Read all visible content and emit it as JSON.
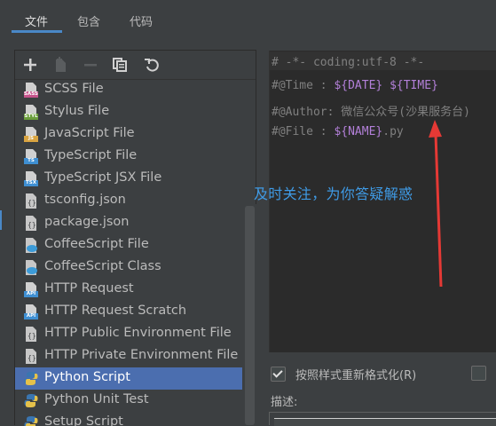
{
  "tabs": [
    {
      "label": "文件",
      "active": true
    },
    {
      "label": "包含",
      "active": false
    },
    {
      "label": "代码",
      "active": false
    }
  ],
  "toolbar": {
    "buttons": [
      "add-icon",
      "copy-template-icon",
      "remove-icon",
      "duplicate-icon",
      "revert-icon"
    ]
  },
  "templates": [
    {
      "label": "SCSS File",
      "badge": "SASS",
      "icon": "scss-file-icon"
    },
    {
      "label": "Stylus File",
      "badge": "STYL",
      "icon": "stylus-file-icon"
    },
    {
      "label": "JavaScript File",
      "badge": "JS",
      "icon": "javascript-file-icon"
    },
    {
      "label": "TypeScript File",
      "badge": "TS",
      "icon": "typescript-file-icon"
    },
    {
      "label": "TypeScript JSX File",
      "badge": "TSX",
      "icon": "tsx-file-icon"
    },
    {
      "label": "tsconfig.json",
      "badge": "",
      "icon": "json-file-icon"
    },
    {
      "label": "package.json",
      "badge": "",
      "icon": "json-file-icon"
    },
    {
      "label": "CoffeeScript File",
      "badge": "",
      "icon": "coffeescript-file-icon"
    },
    {
      "label": "CoffeeScript Class",
      "badge": "",
      "icon": "coffeescript-class-icon"
    },
    {
      "label": "HTTP Request",
      "badge": "API",
      "icon": "http-request-icon"
    },
    {
      "label": "HTTP Request Scratch",
      "badge": "API",
      "icon": "http-request-icon"
    },
    {
      "label": "HTTP Public Environment File",
      "badge": "",
      "icon": "json-file-icon"
    },
    {
      "label": "HTTP Private Environment File",
      "badge": "",
      "icon": "json-file-icon"
    },
    {
      "label": "Python Script",
      "badge": "",
      "icon": "python-icon",
      "selected": true
    },
    {
      "label": "Python Unit Test",
      "badge": "",
      "icon": "python-icon"
    },
    {
      "label": "Setup Script",
      "badge": "",
      "icon": "python-icon"
    }
  ],
  "editor": {
    "line1": "# -*- coding:utf-8 -*-",
    "line2_prefix": "#@Time  : ",
    "line2_var1": "${DATE}",
    "line2_sep": " ",
    "line2_var2": "${TIME}",
    "line3": "#@Author: 微信公众号(沙果服务台)",
    "line4_prefix": "#@File  : ",
    "line4_var": "${NAME}",
    "line4_suffix": ".py"
  },
  "annotation": {
    "text": "及时关注，为你答疑解惑",
    "color": "#3f9be6",
    "arrow_color": "#e53935"
  },
  "options": {
    "reformat_label": "按照样式重新格式化(R)",
    "reformat_checked": true,
    "second_checked": false
  },
  "description": {
    "label": "描述:"
  },
  "colors": {
    "selection": "#4b6eaf",
    "accent": "#4a88c7"
  }
}
